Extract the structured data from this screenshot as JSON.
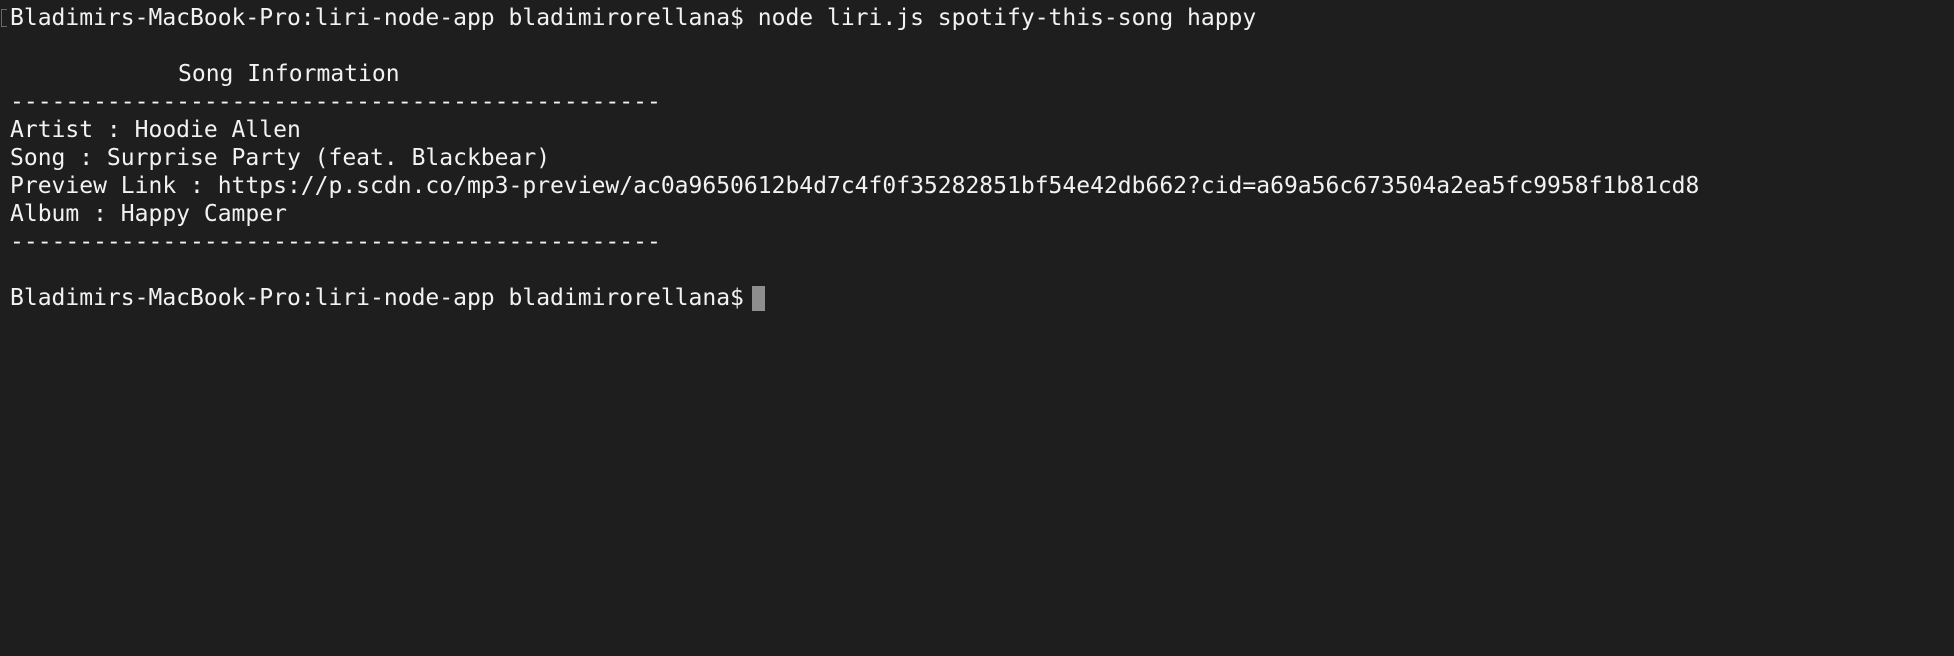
{
  "terminal": {
    "command_line": "Bladimirs-MacBook-Pro:liri-node-app bladimirorellana$ node liri.js spotify-this-song happy",
    "header": "Song Information",
    "separator": "-----------------------------------------------",
    "artist_line": "Artist : Hoodie Allen",
    "song_line": "Song : Surprise Party (feat. Blackbear)",
    "preview_line": "Preview Link : https://p.scdn.co/mp3-preview/ac0a9650612b4d7c4f0f35282851bf54e42db662?cid=a69a56c673504a2ea5fc9958f1b81cd8",
    "album_line": "Album : Happy Camper",
    "prompt": "Bladimirs-MacBook-Pro:liri-node-app bladimirorellana$"
  },
  "colors": {
    "background": "#1e1e1e",
    "text": "#f2f2f2",
    "cursor": "#8e8e8e"
  }
}
